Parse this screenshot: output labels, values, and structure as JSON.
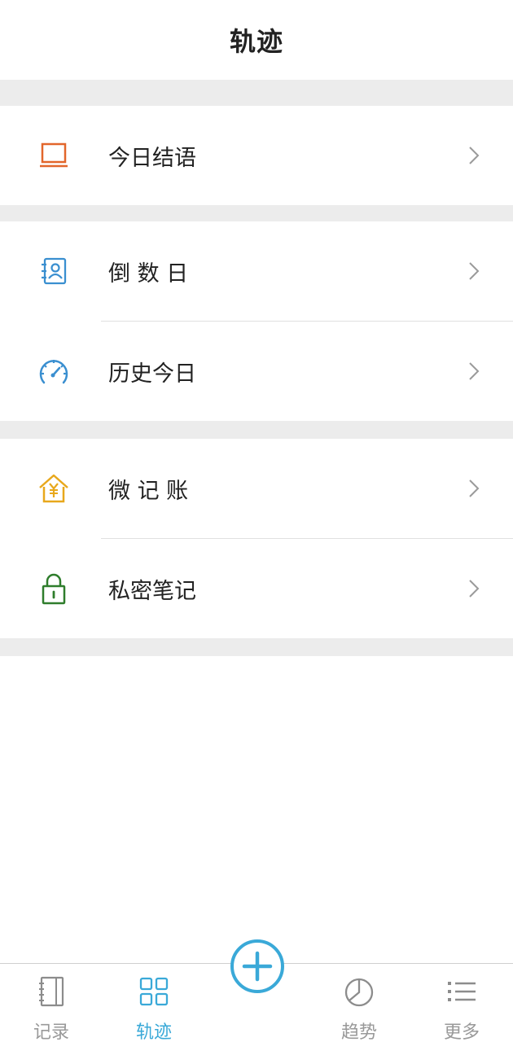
{
  "header": {
    "title": "轨迹"
  },
  "sections": [
    {
      "items": [
        {
          "label": "今日结语",
          "icon": "laptop-icon",
          "color": "#e2662b"
        }
      ]
    },
    {
      "items": [
        {
          "label": "倒 数 日",
          "icon": "contact-card-icon",
          "color": "#3a8fd0"
        },
        {
          "label": "历史今日",
          "icon": "speedometer-icon",
          "color": "#3a8fd0"
        }
      ]
    },
    {
      "items": [
        {
          "label": "微 记 账",
          "icon": "house-yen-icon",
          "color": "#e8a81c"
        },
        {
          "label": "私密笔记",
          "icon": "padlock-icon",
          "color": "#2f7d2c"
        }
      ]
    }
  ],
  "tabbar": {
    "tabs": [
      {
        "label": "记录",
        "icon": "notebook-icon",
        "active": false
      },
      {
        "label": "轨迹",
        "icon": "grid-icon",
        "active": true
      },
      {
        "label": "趋势",
        "icon": "pie-chart-icon",
        "active": false
      },
      {
        "label": "更多",
        "icon": "list-icon",
        "active": false
      }
    ],
    "add_icon": "plus-icon",
    "active_color": "#3aa9d8",
    "inactive_color": "#999999"
  }
}
